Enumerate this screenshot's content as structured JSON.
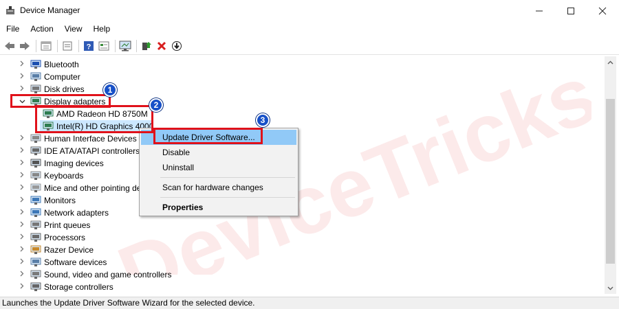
{
  "window": {
    "title": "Device Manager",
    "controls": [
      "minimize-icon",
      "maximize-icon",
      "close-icon"
    ]
  },
  "menubar": {
    "items": [
      "File",
      "Action",
      "View",
      "Help"
    ]
  },
  "toolbar": {
    "icons": [
      "back-arrow-icon",
      "forward-arrow-icon",
      "properties-icon",
      "list-view-icon",
      "help-icon",
      "resources-icon",
      "scan-monitor-icon",
      "add-driver-icon",
      "uninstall-x-icon",
      "download-driver-icon"
    ]
  },
  "tree": {
    "nodes": [
      {
        "label": "Bluetooth",
        "icon": "bluetooth-icon",
        "expanded": false
      },
      {
        "label": "Computer",
        "icon": "computer-icon",
        "expanded": false
      },
      {
        "label": "Disk drives",
        "icon": "disk-drive-icon",
        "expanded": false
      },
      {
        "label": "Display adapters",
        "icon": "display-adapter-icon",
        "expanded": true
      },
      {
        "label": "AMD Radeon HD 8750M",
        "icon": "display-adapter-icon",
        "child": true
      },
      {
        "label": "Intel(R) HD Graphics 4000",
        "icon": "display-adapter-icon",
        "child": true,
        "selected": true
      },
      {
        "label": "Human Interface Devices",
        "icon": "hid-icon",
        "expanded": false
      },
      {
        "label": "IDE ATA/ATAPI controllers",
        "icon": "ide-controller-icon",
        "expanded": false
      },
      {
        "label": "Imaging devices",
        "icon": "camera-icon",
        "expanded": false
      },
      {
        "label": "Keyboards",
        "icon": "keyboard-icon",
        "expanded": false
      },
      {
        "label": "Mice and other pointing devices",
        "icon": "mouse-icon",
        "expanded": false
      },
      {
        "label": "Monitors",
        "icon": "monitor-icon",
        "expanded": false
      },
      {
        "label": "Network adapters",
        "icon": "network-icon",
        "expanded": false
      },
      {
        "label": "Print queues",
        "icon": "printer-icon",
        "expanded": false
      },
      {
        "label": "Processors",
        "icon": "processor-icon",
        "expanded": false
      },
      {
        "label": "Razer Device",
        "icon": "razer-icon",
        "expanded": false
      },
      {
        "label": "Software devices",
        "icon": "software-device-icon",
        "expanded": false
      },
      {
        "label": "Sound, video and game controllers",
        "icon": "sound-icon",
        "expanded": false
      },
      {
        "label": "Storage controllers",
        "icon": "storage-icon",
        "expanded": false
      }
    ]
  },
  "context_menu": {
    "items": [
      {
        "label": "Update Driver Software...",
        "highlighted": true
      },
      {
        "label": "Disable"
      },
      {
        "label": "Uninstall"
      },
      {
        "label": "Scan for hardware changes"
      },
      {
        "label": "Properties",
        "bold": true
      }
    ]
  },
  "annotations": {
    "badges": [
      "1",
      "2",
      "3"
    ],
    "color": "#e0111a",
    "badge_color": "#1750c8"
  },
  "watermark": {
    "text": "DeviceTricks"
  },
  "status": {
    "text": "Launches the Update Driver Software Wizard for the selected device."
  }
}
